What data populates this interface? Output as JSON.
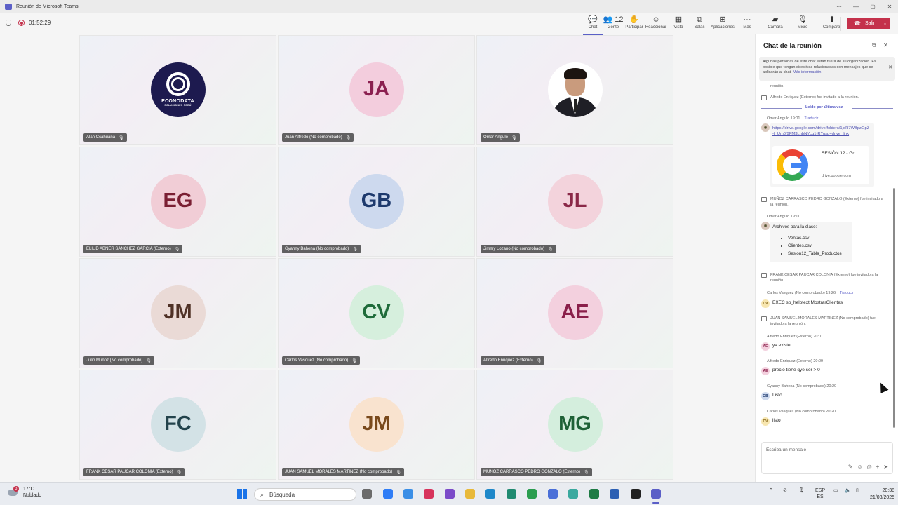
{
  "window": {
    "title": "Reunión de Microsoft Teams",
    "minimize": "—",
    "maximize": "▢",
    "close": "✕",
    "more": "···"
  },
  "meeting": {
    "timer": "01:52:29",
    "toolbar": [
      {
        "label": "Chat",
        "icon": "chat-icon",
        "glyph": "💬",
        "badge": ""
      },
      {
        "label": "Gente",
        "icon": "people-icon",
        "glyph": "👥",
        "badge": "12"
      },
      {
        "label": "Participar",
        "icon": "raise-hand-icon",
        "glyph": "✋",
        "badge": ""
      },
      {
        "label": "Reaccionar",
        "icon": "react-icon",
        "glyph": "☺",
        "badge": ""
      },
      {
        "label": "Vista",
        "icon": "view-icon",
        "glyph": "▦",
        "badge": ""
      },
      {
        "label": "Salas",
        "icon": "rooms-icon",
        "glyph": "⧉",
        "badge": ""
      },
      {
        "label": "Aplicaciones",
        "icon": "apps-icon",
        "glyph": "⊞",
        "badge": ""
      },
      {
        "label": "Más",
        "icon": "more-icon",
        "glyph": "···",
        "badge": ""
      },
      {
        "label": "Cámara",
        "icon": "camera-off-icon",
        "glyph": "▰",
        "badge": ""
      },
      {
        "label": "Micro",
        "icon": "mic-off-icon",
        "glyph": "🎙",
        "badge": ""
      },
      {
        "label": "Compartir",
        "icon": "share-icon",
        "glyph": "⬆",
        "badge": ""
      }
    ],
    "leave_label": "Salir"
  },
  "participants": [
    {
      "name": "Alan Ccahuana",
      "initials": "",
      "kind": "logo",
      "logo_line1": "ECONODATA",
      "logo_line2": "SOLUCIONES PERÚ",
      "bg": "#1d1a4f",
      "fg": "#ffffff"
    },
    {
      "name": "Juan Alfredo (No comprobado)",
      "initials": "JA",
      "kind": "initials",
      "bg": "#f3cddd",
      "fg": "#8b2050"
    },
    {
      "name": "Omar Angulo",
      "initials": "",
      "kind": "photo",
      "bg": "#ffffff",
      "fg": "#000000"
    },
    {
      "name": "ELIUD ABNER SANCHEZ GARCIA (Externo)",
      "initials": "EG",
      "kind": "initials",
      "bg": "#f1cdd6",
      "fg": "#7a1f33"
    },
    {
      "name": "Gyanny Bahena (No comprobado)",
      "initials": "GB",
      "kind": "initials",
      "bg": "#cdd9ee",
      "fg": "#1e3a6d"
    },
    {
      "name": "Jimmy Lozano (No comprobado)",
      "initials": "JL",
      "kind": "initials",
      "bg": "#f3d3dc",
      "fg": "#8a2848"
    },
    {
      "name": "Julio Munoz (No comprobado)",
      "initials": "JM",
      "kind": "initials",
      "bg": "#eadad6",
      "fg": "#4f3126"
    },
    {
      "name": "Carlos Vasquez (No comprobado)",
      "initials": "CV",
      "kind": "initials",
      "bg": "#d6efdd",
      "fg": "#1f6b3a"
    },
    {
      "name": "Alfredo Enriquez (Externo)",
      "initials": "AE",
      "kind": "initials",
      "bg": "#f3d0de",
      "fg": "#8a1f4a"
    },
    {
      "name": "FRANK CESAR PAUCAR COLONIA (Externo)",
      "initials": "FC",
      "kind": "initials",
      "bg": "#d3e2e6",
      "fg": "#23434c"
    },
    {
      "name": "JUAN SAMUEL MORALES MARTINEZ (No comprobado)",
      "initials": "JM",
      "kind": "initials",
      "bg": "#f9e3cf",
      "fg": "#7a4a1d"
    },
    {
      "name": "MUÑOZ CARRASCO PEDRO GONZALO (Externo)",
      "initials": "MG",
      "kind": "initials",
      "bg": "#d4eedd",
      "fg": "#1e6136"
    }
  ],
  "chat": {
    "title": "Chat de la reunión",
    "banner_text": "Algunas personas de este chat están fuera de su organización. Es posible que tengan directivas relacionadas con mensajes que se aplicarán al chat.",
    "banner_link": "Más información",
    "events": {
      "e0": "reunión.",
      "e1": "Alfredo Enriquez (Externo) fue invitado a la reunión.",
      "e2": "MUÑOZ CARRASCO PEDRO GONZALO (Externo) fue invitado a la reunión.",
      "e3": "FRANK CESAR PAUCAR COLONIA (Externo) fue invitado a la reunión.",
      "e4": "JUAN SAMUEL MORALES MARTINEZ (No comprobado) fue invitado a la reunión."
    },
    "read_marker": "Leído por última vez",
    "translate": "Traducir",
    "m1": {
      "author": "Omar Angulo",
      "time": "19:01",
      "url": "https://drive.google.com/drive/folders/1jqR7WBpzGpZ-f_Um0f9FM3LnbNYcq1-R?usp=drive_link",
      "card_title": "SESIÓN 12 - Go...",
      "card_domain": "drive.google.com"
    },
    "m2": {
      "author": "Omar Angulo",
      "time": "19:11",
      "text": "Archivos para la clase:",
      "files": [
        "Ventas.csv",
        "Clientes.csv",
        "Sesion12_Tabla_Productos"
      ]
    },
    "m3": {
      "author": "Carlos Vasquez (No comprobado)",
      "time": "19:26",
      "initials": "CV",
      "text": "EXEC sp_helptext MostrarClientes"
    },
    "m4": {
      "author": "Alfredo Enriquez (Externo)",
      "time": "20:01",
      "initials": "AE",
      "text": "ya existe"
    },
    "m5": {
      "author": "Alfredo Enriquez (Externo)",
      "time": "20:09",
      "initials": "AE",
      "text": "precio tiene qye ser > 0"
    },
    "m6": {
      "author": "Gyanny Bahena (No comprobado)",
      "time": "20:20",
      "initials": "GB",
      "text": "Listo"
    },
    "m7": {
      "author": "Carlos Vasquez (No comprobado)",
      "time": "20:20",
      "initials": "CV",
      "text": "listo"
    },
    "compose_placeholder": "Escriba un mensaje"
  },
  "taskbar": {
    "temperature": "17°C",
    "weather": "Nublado",
    "weather_badge": "3",
    "search_placeholder": "Búsqueda",
    "lang1": "ESP",
    "lang2": "ES",
    "time": "20:38",
    "date": "21/08/2025",
    "apps": [
      "file-explorer-icon",
      "copilot-icon",
      "text-editor-icon",
      "snipping-icon",
      "visual-studio-icon",
      "folder-icon",
      "edge-icon",
      "notepad-icon",
      "chrome-icon",
      "chrome-profile-icon",
      "chrome-profile-2-icon",
      "excel-icon",
      "word-icon",
      "app-icon",
      "teams-icon"
    ]
  }
}
